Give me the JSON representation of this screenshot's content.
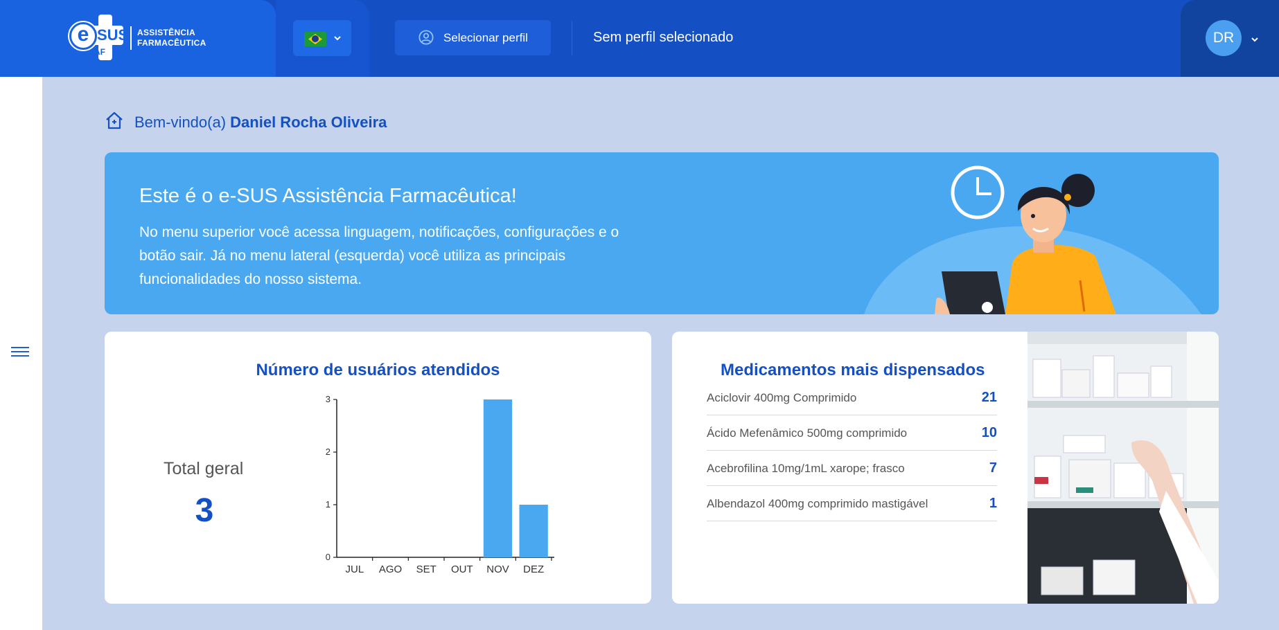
{
  "header": {
    "logo": {
      "e": "e",
      "sus": "SUS",
      "af": "AF",
      "line1": "ASSISTÊNCIA",
      "line2": "FARMACÊUTICA"
    },
    "select_profile_label": "Selecionar perfil",
    "no_profile_text": "Sem perfil selecionado",
    "avatar_initials": "DR"
  },
  "welcome": {
    "prefix": "Bem-vindo(a)",
    "user_name": "Daniel Rocha Oliveira"
  },
  "banner": {
    "title": "Este é o e-SUS Assistência Farmacêutica!",
    "text": "No menu superior você acessa linguagem, notificações, configurações e o botão sair. Já no menu lateral (esquerda) você utiliza as principais funcionalidades do nosso sistema."
  },
  "users_card": {
    "title": "Número de usuários atendidos",
    "total_label": "Total geral",
    "total_value": "3"
  },
  "meds_card": {
    "title": "Medicamentos mais dispensados",
    "items": [
      {
        "name": "Aciclovir 400mg Comprimido",
        "count": "21"
      },
      {
        "name": "Ácido Mefenâmico 500mg comprimido",
        "count": "10"
      },
      {
        "name": "Acebrofilina 10mg/1mL xarope; frasco",
        "count": "7"
      },
      {
        "name": "Albendazol 400mg comprimido mastigável",
        "count": "1"
      }
    ]
  },
  "colors": {
    "primary": "#1450c4",
    "accent": "#4aa8f0",
    "background": "#c5d3ec"
  },
  "icons": {
    "home": "home-icon",
    "user": "user-circle-icon",
    "menu": "hamburger-icon",
    "chevron": "chevron-down-icon",
    "flag": "brazil-flag-icon"
  },
  "chart_data": {
    "type": "bar",
    "categories": [
      "JUL",
      "AGO",
      "SET",
      "OUT",
      "NOV",
      "DEZ"
    ],
    "values": [
      0,
      0,
      0,
      0,
      3,
      1
    ],
    "ylim": [
      0,
      3
    ],
    "yticks": [
      0,
      1,
      2,
      3
    ],
    "title": "",
    "xlabel": "",
    "ylabel": "",
    "grid": false,
    "color": "#4aa8f0"
  }
}
